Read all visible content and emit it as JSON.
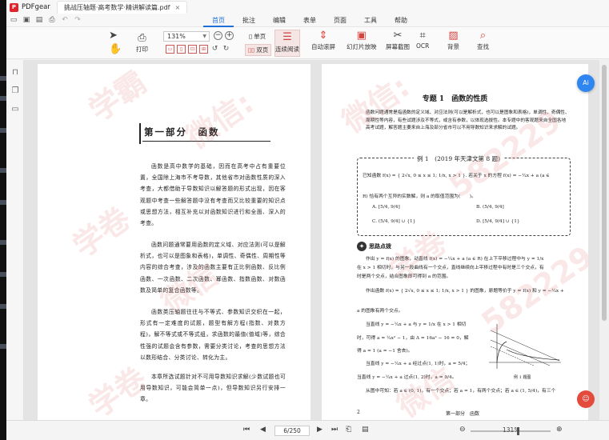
{
  "window": {
    "app_name": "PDFgear",
    "doc_tab": "挑战压轴题·高考数学·精讲解读篇.pdf",
    "close_glyph": "×"
  },
  "menu": {
    "items": [
      "首页",
      "批注",
      "编辑",
      "表单",
      "页面",
      "工具",
      "帮助"
    ],
    "active_index": 0
  },
  "ribbon": {
    "print": "打印",
    "zoom_value": "131%",
    "single_page": "单页",
    "double_page": "双页",
    "continuous_read": "连续阅读",
    "auto_scroll": "自动滚屏",
    "slideshow": "幻灯片放映",
    "screenshot": "屏幕截图",
    "ocr": "OCR",
    "background": "背景",
    "find": "查找"
  },
  "left_page": {
    "part_title": "第一部分　函数",
    "paragraphs": [
      "函数是高中数学的基础，因而在高考中占有重要位置，全国除上海市不考导数，其他省市对函数性质的深入考查，大都借助于导数知识以解答题的形式出现，因在客观题中考查一些解答题中没有考查而又比较重要的知识点或思想方法，相互补充以对函数知识进行和全面、深入的考查。",
      "函数问题通常要用函数的定义域、对应法则(可以是解析式，也可以是图象和表格)，单调性、奇偶性、周期性等内容的综合考查，涉及的函数主要有正比例函数、反比例函数、一次函数、二次函数、幂函数、指数函数、对数函数及简单的复合函数等。",
      "函数类压轴题往往与不等式、参数知识交织在一起，形式有一定难度的试题，题型有解方程(指数、对数方程)，解不等式或不等式组，求函数的最值(值域)等，综合性强的试题会含有参数，需要分类讨论，考查的思想方法以数形结合、分类讨论、转化为主。",
      "本章所选试题针对不可用导数知识求解(少数试题也可用导数知识，可能会简单一点)，但导数知识另行安排一章。"
    ]
  },
  "right_page": {
    "chapter_title": "专题 1　函数的性质",
    "intro": "函数问题通常是指函数的定义域、对应法则(可以是解析式，也可以是图象和表格)，单调性、奇偶性、周期性等内容，有些试题涉及不等式，或含有参数，以体现选拔性。本专题中的客观题来自全国各地高考试题，解答题主要来自上海及部分省市可以不用导数知识来求解的试题。",
    "example_head": "例 1　(2019 年天津文第 8 题)",
    "example_given": "已知函数 f(x) = { 2√x, 0 ≤ x ≤ 1;  1/x, x > 1 }.  若关于 x 的方程 f(x) = −¼x + a (a ∈",
    "example_question": "R) 恰有两个互异的实数解，则 a 的取值范围为(　　)。",
    "options": [
      "A. [5/4, 9/4]",
      "B. (5/4, 9/4]",
      "C. (5/4, 9/4] ∪ {1}",
      "D. [5/4, 9/4] ∪ {1}"
    ],
    "think_label": "思路点拨",
    "body_lines": [
      "作出 y = f(x) 的图象，动直线 f(x) = −¼x + a (a ∈ R) 在上下平移过程中与 y = 1/x",
      "在 x > 1 相切时，与另一段曲线有一个交点，直线继续向上平移过程中有时是三个交点，有",
      "时是两个交点，结合图象即可得到 a 的范围。",
      "作出函数 f(x) = { 2√x, 0 ≤ x ≤ 1; 1/x, x > 1 } 的图象，原题等价于 y = f(x) 和 y = −¼x +",
      "a 的图象有两个交点。",
      "当直线 y = −¼x + a 与 y = 1/x 在 x > 1 相切",
      "时，可得 a = ¼x² − 1，由 Δ = 16a² − 16 = 0，解",
      "得 a = 1 (a = −1 舍去)。",
      "当直线 y = −¼x + a 经过点(1, 1)时，a = 5/4；",
      "当直线 y = −¼x + a 过点(1, 2)时，a = 9/4。",
      "从图中可知：若 a ∈ (0, 1)，有一个交点；若 a = 1，有两个交点；若 a ∈ (1, 5/4)，有三个"
    ],
    "graph_caption": "例 1 题图",
    "footer_page": "2",
    "footer_center": "第一部分　函数"
  },
  "watermarks": [
    "学霸",
    "微信:",
    "582229",
    "学卷",
    "微信",
    "582229",
    "学卷",
    "微信"
  ],
  "statusbar": {
    "page_indicator": "6/250",
    "zoom": "131%"
  },
  "floating": {
    "ai_button": "Ai",
    "feedback_button": "☺"
  },
  "colors": {
    "accent": "#1f6fd6",
    "brand_red": "#e1242c",
    "selected_fill": "#f5e6e5",
    "watermark": "#e27878"
  },
  "icons": {
    "toolbar": [
      "folder-icon",
      "save-icon",
      "save-as-icon",
      "print-quick-icon",
      "undo-icon",
      "redo-icon"
    ],
    "sidebar": [
      "bookmark-icon",
      "pages-icon",
      "comments-icon"
    ]
  }
}
